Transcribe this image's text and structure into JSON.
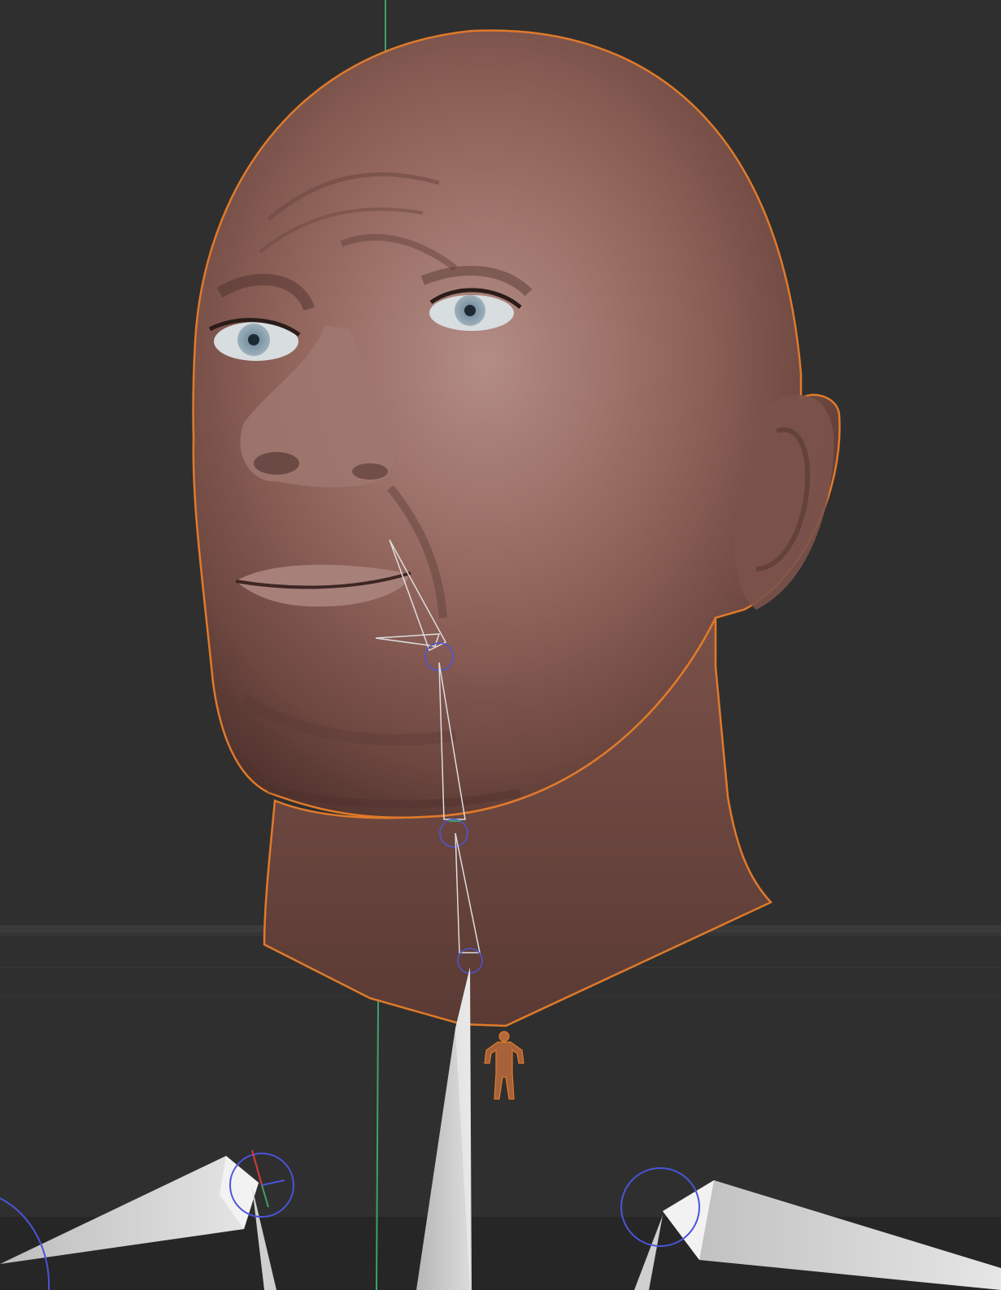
{
  "viewport": {
    "scene": "3d-sculpt-viewport",
    "selected_object": "head-mesh",
    "selection_outline_color": "#e07a2a",
    "background_color": "#2f2f2f",
    "floor_band_color": "#262626",
    "axis_line_color": "#3fa06a",
    "bone_color": "#d9d9d9",
    "gizmo_ring_color": "#4a55d8",
    "skin_color": "#8a5e54",
    "icons": [
      "bone-gizmo-icon",
      "armature-figure-icon",
      "rotation-ring-icon"
    ]
  }
}
